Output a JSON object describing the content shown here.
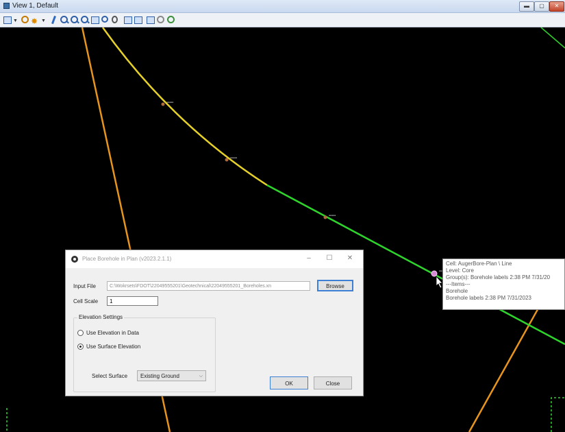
{
  "window": {
    "title": "View 1, Default",
    "controls": [
      "minimize-icon",
      "maximize-icon",
      "close-icon"
    ]
  },
  "toolbar": {
    "icons": [
      "view-display-icon",
      "dropdown-arrow-icon",
      "view-attributes-icon",
      "sparkle-icon",
      "dropdown-arrow-icon",
      "pan-hand-icon",
      "zoom-in-icon",
      "zoom-out-icon",
      "window-area-icon",
      "fit-view-icon",
      "rotate-view-icon",
      "view-previous-icon",
      "view-next-icon",
      "copy-view-icon",
      "camera-icon",
      "clip-volume-icon",
      "walk-icon"
    ]
  },
  "canvas": {
    "background": "#000000",
    "line_colors": {
      "orange": "#e8951e",
      "yellow": "#e6d12a",
      "green": "#2fd42c",
      "cursor_point": "#d98ad6"
    }
  },
  "tooltip": {
    "lines": [
      "Cell: AugerBore-Plan \\ Line",
      "Level: Core",
      "Group(s): Borehole labels 2:38 PM 7/31/20",
      "---Items---",
      "Borehole",
      "Borehole labels 2:38 PM 7/31/2023"
    ]
  },
  "dialog": {
    "title": "Place Borehole in Plan (v2023.2.1.1)",
    "input_file_label": "Input File",
    "input_file_value": "C:\\Wokrsets\\FDOT\\22049555201\\Geotechnical\\22049555201_Boreholes.xn",
    "browse_label": "Browse",
    "cell_scale_label": "Cell Scale",
    "cell_scale_value": "1",
    "elevation_settings_label": "Elevation Settings",
    "use_elevation_in_data_label": "Use Elevation in Data",
    "use_surface_elevation_label": "Use Surface Elevation",
    "select_surface_label": "Select Surface",
    "select_surface_value": "Existing Ground",
    "ok_label": "OK",
    "close_label": "Close",
    "selected_elevation_option": "Use Surface Elevation"
  }
}
